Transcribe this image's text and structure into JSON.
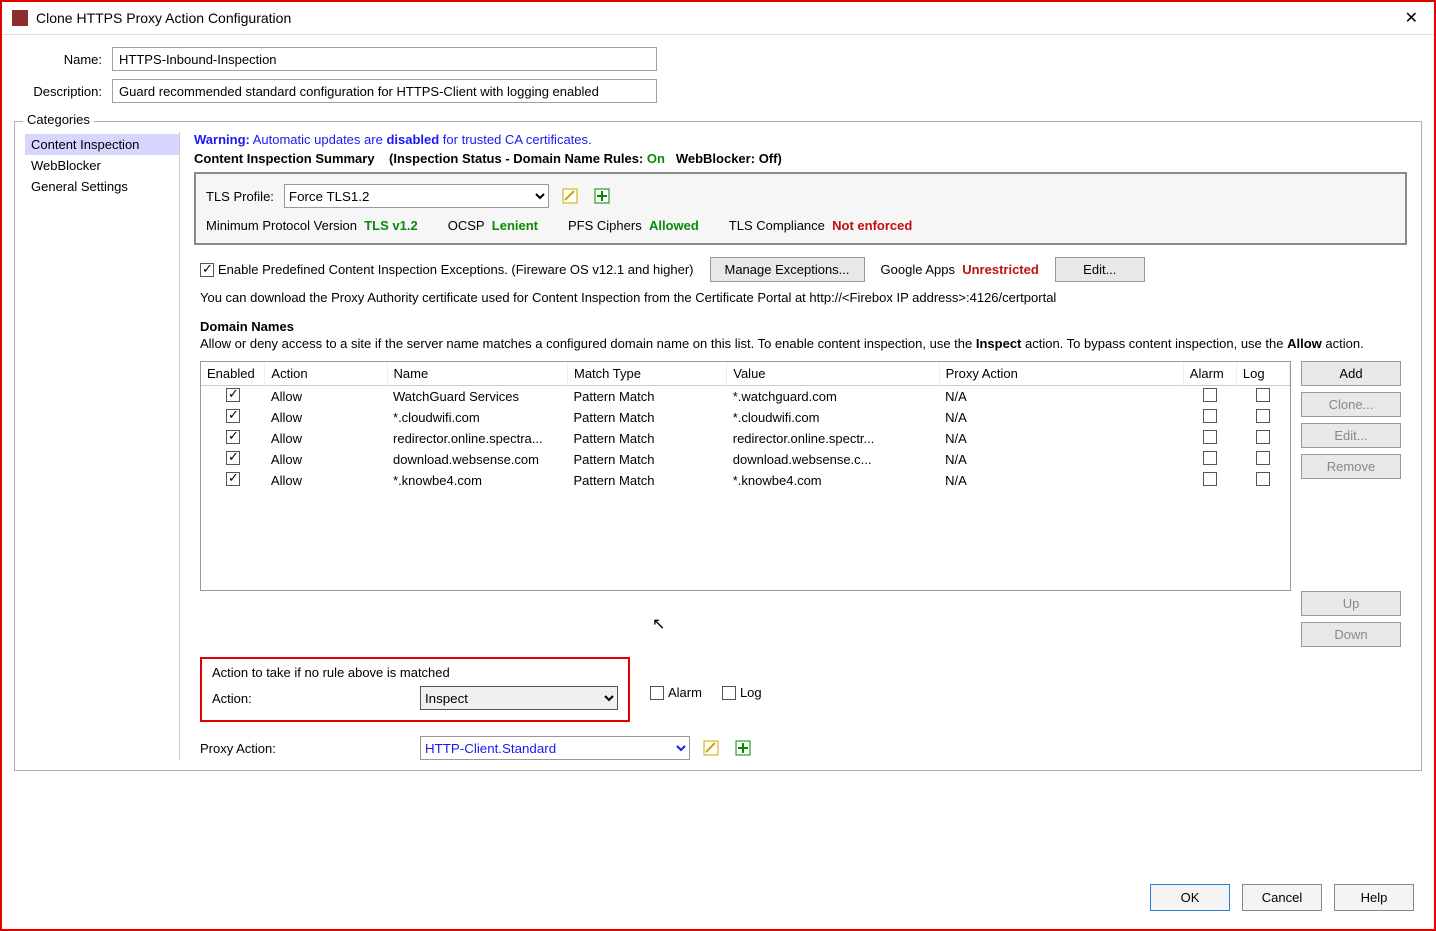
{
  "window": {
    "title": "Clone HTTPS Proxy Action Configuration"
  },
  "fields": {
    "name_label": "Name:",
    "name_value": "HTTPS-Inbound-Inspection",
    "desc_label": "Description:",
    "desc_value": "Guard recommended standard configuration for HTTPS-Client with logging enabled"
  },
  "categories": {
    "legend": "Categories",
    "items": [
      {
        "label": "Content Inspection",
        "selected": true
      },
      {
        "label": "WebBlocker",
        "selected": false
      },
      {
        "label": "General Settings",
        "selected": false
      }
    ]
  },
  "warning": {
    "prefix": "Warning:",
    "text_a": " Automatic updates are ",
    "bold": "disabled",
    "text_b": " for trusted CA certificates."
  },
  "summary": {
    "heading": "Content Inspection Summary",
    "sub": "(Inspection Status  -  Domain Name Rules:",
    "on": "On",
    "wb_label": "WebBlocker:",
    "off": "Off)"
  },
  "tls": {
    "profile_label": "TLS Profile:",
    "profile_value": "Force TLS1.2",
    "min_label": "Minimum Protocol Version",
    "min_value": "TLS v1.2",
    "ocsp_label": "OCSP",
    "ocsp_value": "Lenient",
    "pfs_label": "PFS Ciphers",
    "pfs_value": "Allowed",
    "comp_label": "TLS Compliance",
    "comp_value": "Not enforced"
  },
  "exceptions": {
    "checkbox_label": "Enable Predefined Content Inspection Exceptions. (Fireware OS v12.1 and higher)",
    "manage_btn": "Manage Exceptions...",
    "google_label": "Google Apps",
    "google_value": "Unrestricted",
    "edit_btn": "Edit..."
  },
  "info_line": "You can download the Proxy Authority certificate used for Content Inspection from the Certificate Portal at http://<Firebox IP address>:4126/certportal",
  "domain_names": {
    "heading": "Domain Names",
    "desc_a": "Allow or deny access to a site if the server name matches a configured domain name on this list. To enable content inspection, use the ",
    "kw1": "Inspect",
    "desc_b": " action. To bypass content inspection, use the ",
    "kw2": "Allow",
    "desc_c": " action.",
    "cols": {
      "enabled": "Enabled",
      "action": "Action",
      "name": "Name",
      "match": "Match Type",
      "value": "Value",
      "proxy": "Proxy Action",
      "alarm": "Alarm",
      "log": "Log"
    },
    "rows": [
      {
        "enabled": true,
        "action": "Allow",
        "name": "WatchGuard Services",
        "match": "Pattern Match",
        "value": "*.watchguard.com",
        "proxy": "N/A",
        "alarm": false,
        "log": false
      },
      {
        "enabled": true,
        "action": "Allow",
        "name": "*.cloudwifi.com",
        "match": "Pattern Match",
        "value": "*.cloudwifi.com",
        "proxy": "N/A",
        "alarm": false,
        "log": false
      },
      {
        "enabled": true,
        "action": "Allow",
        "name": "redirector.online.spectra...",
        "match": "Pattern Match",
        "value": "redirector.online.spectr...",
        "proxy": "N/A",
        "alarm": false,
        "log": false
      },
      {
        "enabled": true,
        "action": "Allow",
        "name": "download.websense.com",
        "match": "Pattern Match",
        "value": "download.websense.c...",
        "proxy": "N/A",
        "alarm": false,
        "log": false
      },
      {
        "enabled": true,
        "action": "Allow",
        "name": "*.knowbe4.com",
        "match": "Pattern Match",
        "value": "*.knowbe4.com",
        "proxy": "N/A",
        "alarm": false,
        "log": false
      }
    ],
    "side_buttons": {
      "add": "Add",
      "clone": "Clone...",
      "edit": "Edit...",
      "remove": "Remove",
      "up": "Up",
      "down": "Down"
    }
  },
  "no_match": {
    "heading": "Action to take if no rule above is matched",
    "action_label": "Action:",
    "action_value": "Inspect",
    "alarm_label": "Alarm",
    "log_label": "Log"
  },
  "proxy_action": {
    "label": "Proxy Action:",
    "value": "HTTP-Client.Standard"
  },
  "dialog": {
    "ok": "OK",
    "cancel": "Cancel",
    "help": "Help"
  }
}
